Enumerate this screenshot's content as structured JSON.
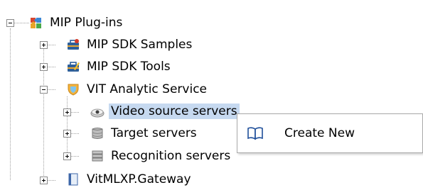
{
  "tree": {
    "root": {
      "label": "MIP Plug-ins",
      "icon": "puzzle-icon",
      "expanded": true
    },
    "children": [
      {
        "label": "MIP SDK Samples",
        "icon": "toolbox-icon",
        "expanded": false
      },
      {
        "label": "MIP SDK Tools",
        "icon": "toolbox-pencil-icon",
        "expanded": false
      },
      {
        "label": "VIT Analytic Service",
        "icon": "shield-icon",
        "expanded": true,
        "children": [
          {
            "label": "Video source servers",
            "icon": "camera-icon",
            "expanded": false,
            "selected": true
          },
          {
            "label": "Target servers",
            "icon": "database-icon",
            "expanded": false
          },
          {
            "label": "Recognition servers",
            "icon": "server-icon",
            "expanded": false
          }
        ]
      },
      {
        "label": "VitMLXP.Gateway",
        "icon": "book-icon",
        "expanded": false
      }
    ]
  },
  "context_menu": {
    "items": [
      {
        "label": "Create New",
        "icon": "book-icon"
      }
    ]
  },
  "colors": {
    "selection": "#c6d9f0",
    "menu_border": "#a8a8a8",
    "tree_lines": "#a0a0a0"
  }
}
